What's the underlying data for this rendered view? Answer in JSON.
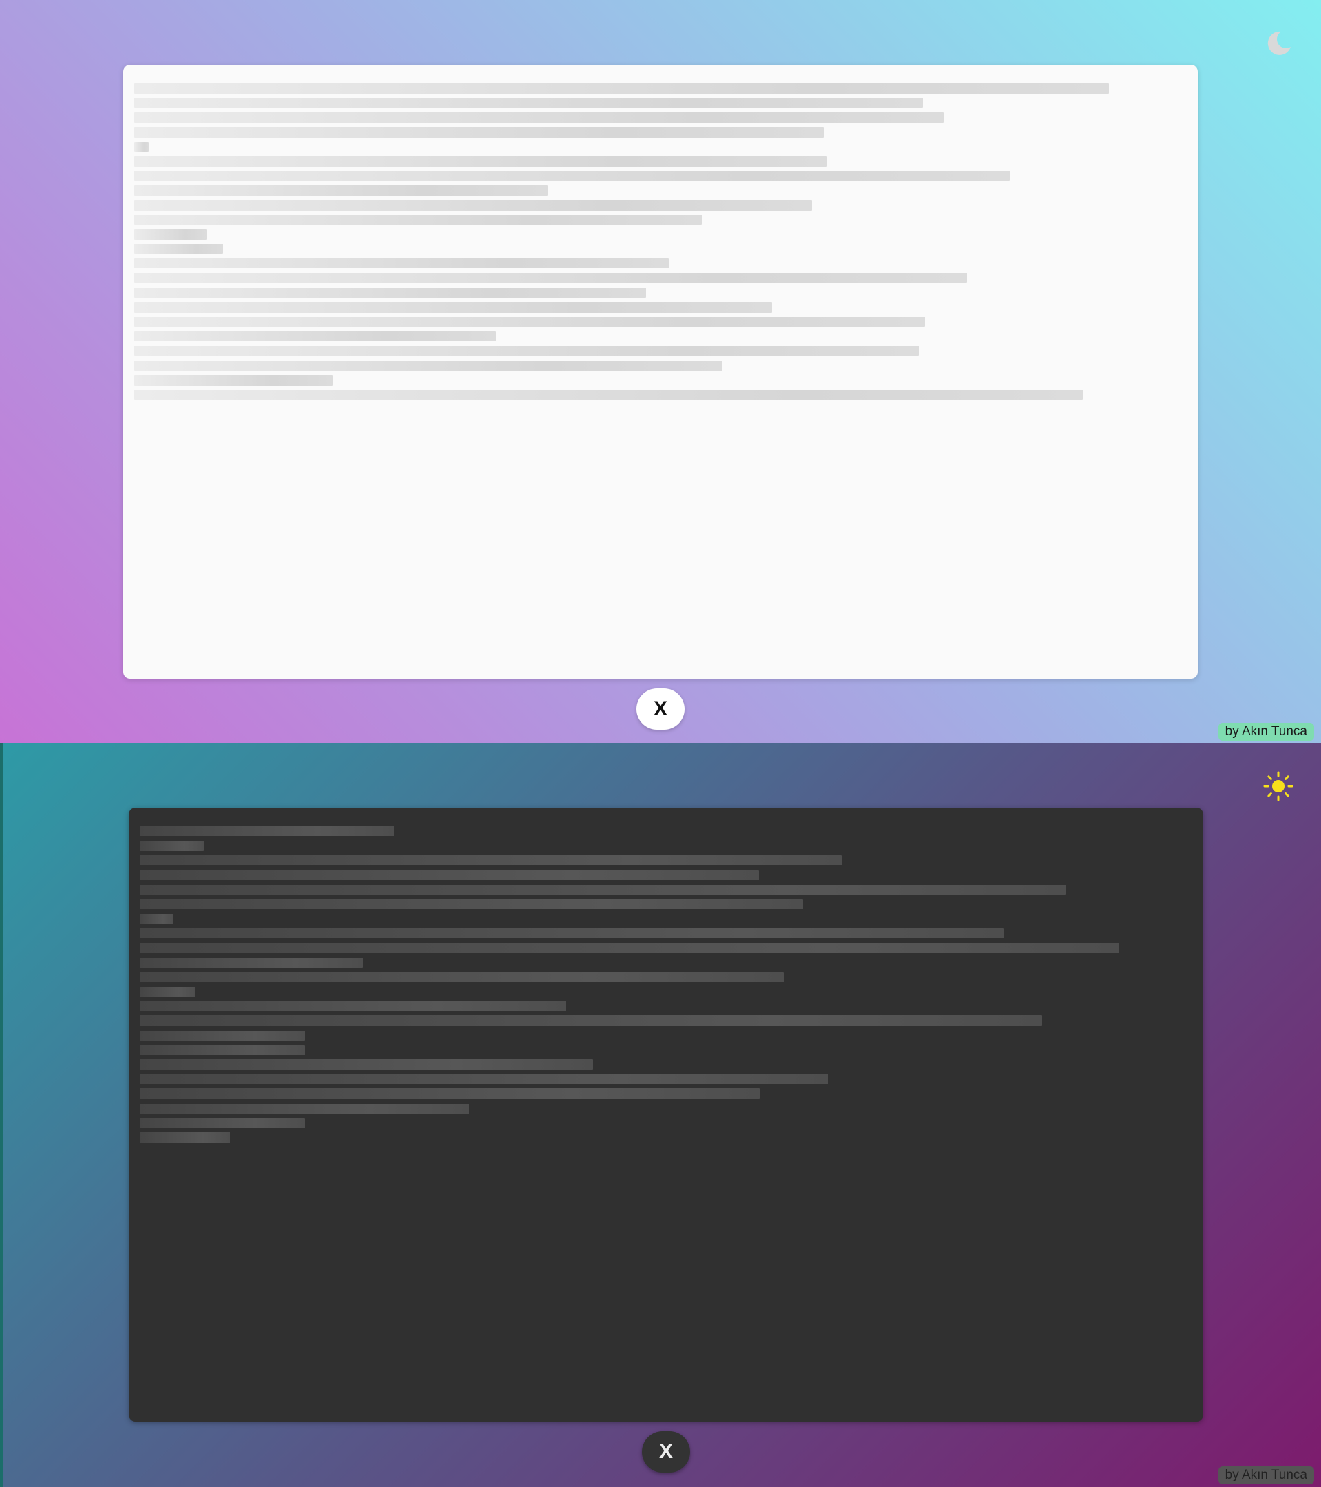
{
  "light": {
    "theme_icon": "moon-icon",
    "close_label": "X",
    "credit": "by Akın Tunca",
    "skeleton_lines": [
      0.926,
      0.749,
      0.769,
      0.655,
      0.014,
      0.658,
      0.832,
      0.393,
      0.644,
      0.539,
      0.069,
      0.084,
      0.508,
      0.791,
      0.486,
      0.606,
      0.751,
      0.344,
      0.745,
      0.559,
      0.189,
      0.901
    ]
  },
  "dark": {
    "theme_icon": "sun-icon",
    "close_label": "X",
    "credit": "by Akın Tunca",
    "skeleton_lines": [
      0.242,
      0.061,
      0.667,
      0.588,
      0.88,
      0.63,
      0.032,
      0.821,
      0.931,
      0.212,
      0.612,
      0.053,
      0.405,
      0.857,
      0.157,
      0.157,
      0.431,
      0.654,
      0.589,
      0.313,
      0.157,
      0.086
    ]
  },
  "colors": {
    "moon": "#d9d9d9",
    "sun": "#f7e01c"
  }
}
